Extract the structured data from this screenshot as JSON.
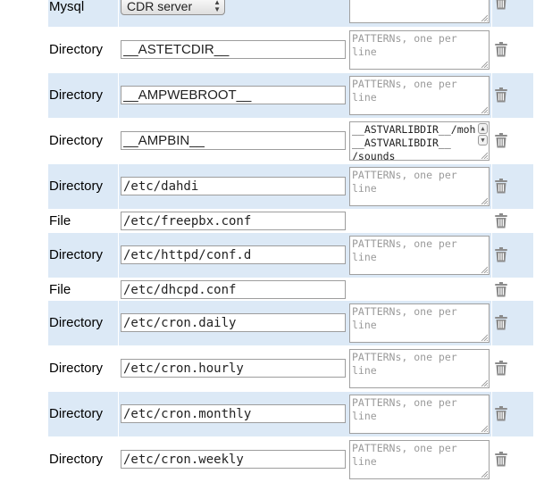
{
  "pattern_placeholder": "PATTERNs, one per\nline",
  "top_row": {
    "type": "Mysql",
    "server_select": "CDR server",
    "pattern_placeholder": "line"
  },
  "rows": [
    {
      "type": "Directory",
      "path": "__ASTETCDIR__"
    },
    {
      "type": "Directory",
      "path": "__AMPWEBROOT__"
    },
    {
      "type": "Directory",
      "path": "__AMPBIN__",
      "patterns": [
        "__ASTVARLIBDIR__/moh",
        "__ASTVARLIBDIR__",
        "/sounds"
      ]
    },
    {
      "type": "Directory",
      "path": "/etc/dahdi"
    },
    {
      "type": "File",
      "path": "/etc/freepbx.conf"
    },
    {
      "type": "Directory",
      "path": "/etc/httpd/conf.d"
    },
    {
      "type": "File",
      "path": "/etc/dhcpd.conf"
    },
    {
      "type": "Directory",
      "path": "/etc/cron.daily"
    },
    {
      "type": "Directory",
      "path": "/etc/cron.hourly"
    },
    {
      "type": "Directory",
      "path": "/etc/cron.monthly"
    },
    {
      "type": "Directory",
      "path": "/etc/cron.weekly"
    }
  ],
  "colors": {
    "row_alt": "#dce9f6",
    "input_border": "#9d9d9d",
    "placeholder": "#9a9a9a",
    "trash": "#8c8c8c"
  },
  "icons": {
    "delete": "trash-icon",
    "resize": "resize-grip-icon"
  }
}
